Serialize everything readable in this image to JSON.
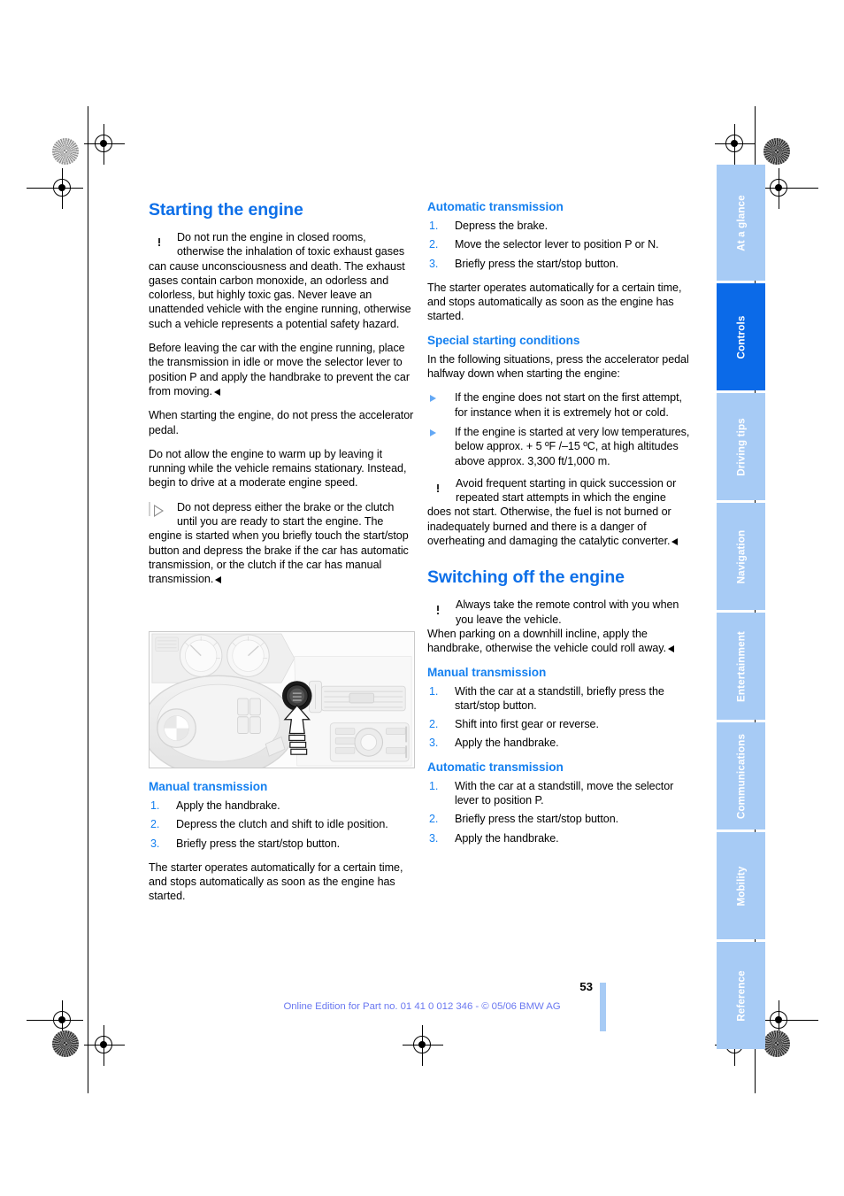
{
  "document": {
    "page_number": "53",
    "footer_note": "Online Edition for Part no. 01 41 0 012 346 - © 05/06 BMW AG"
  },
  "colors": {
    "heading_blue": "#0d6fe8",
    "subheading_blue": "#1580f0",
    "tab_blue": "#a7cbf5",
    "tab_active_blue": "#0b6ae8",
    "footer_blue": "#6a78f0"
  },
  "left_column": {
    "title": "Starting the engine",
    "warning_1": "Do not run the engine in closed rooms, otherwise the inhalation of toxic exhaust gases can cause unconsciousness and death. The exhaust gases contain carbon monoxide, an odorless and colorless, but highly toxic gas. Never leave an unattended vehicle with the engine running, otherwise such a vehicle represents a potential safety hazard.",
    "warning_1b": "Before leaving the car with the engine running, place the transmission in idle or move the selector lever to position P and apply the handbrake to prevent the car from moving.",
    "para_1": "When starting the engine, do not press the accelerator pedal.",
    "para_2": "Do not allow the engine to warm up by leaving it running while the vehicle remains stationary. Instead, begin to drive at a moderate engine speed.",
    "note_1": "Do not depress either the brake or the clutch until you are ready to start the engine. The engine is started when you briefly touch the start/stop button and depress the brake if the car has automatic transmission, or the clutch if the car has manual transmission.",
    "figure_caption": "Dashboard view showing the start/stop button next to the steering wheel, indicated by an arrow",
    "manual_transmission": {
      "heading": "Manual transmission",
      "steps": [
        "Apply the handbrake.",
        "Depress the clutch and shift to idle position.",
        "Briefly press the start/stop button."
      ],
      "closing": "The starter operates automatically for a certain time, and stops automatically as soon as the engine has started."
    }
  },
  "right_column": {
    "automatic_transmission_start": {
      "heading": "Automatic transmission",
      "steps": [
        "Depress the brake.",
        "Move the selector lever to position P or N.",
        "Briefly press the start/stop button."
      ],
      "closing": "The starter operates automatically for a certain time, and stops automatically as soon as the engine has started."
    },
    "special_starting_conditions": {
      "heading": "Special starting conditions",
      "intro": "In the following situations, press the accelerator pedal halfway down when starting the engine:",
      "bullets": [
        "If the engine does not start on the first attempt, for instance when it is extremely hot or cold.",
        "If the engine is started at very low temperatures, below approx. + 5 ºF /–15 ºC, at high altitudes above approx. 3,300 ft/1,000 m."
      ],
      "warning": "Avoid frequent starting in quick succession or repeated start attempts in which the engine does not start. Otherwise, the fuel is not burned or inadequately burned and there is a danger of overheating and damaging the catalytic converter."
    },
    "switching_off": {
      "title": "Switching off the engine",
      "warning": "Always take the remote control with you when you leave the vehicle.",
      "warning_b": "When parking on a downhill incline, apply the handbrake, otherwise the vehicle could roll away.",
      "manual_transmission": {
        "heading": "Manual transmission",
        "steps": [
          "With the car at a standstill, briefly press the start/stop button.",
          "Shift into first gear or reverse.",
          "Apply the handbrake."
        ]
      },
      "automatic_transmission": {
        "heading": "Automatic transmission",
        "steps": [
          "With the car at a standstill, move the selector lever to position P.",
          "Briefly press the start/stop button.",
          "Apply the handbrake."
        ]
      }
    }
  },
  "tabs": [
    {
      "label": "At a glance",
      "active": false
    },
    {
      "label": "Controls",
      "active": true
    },
    {
      "label": "Driving tips",
      "active": false
    },
    {
      "label": "Navigation",
      "active": false
    },
    {
      "label": "Entertainment",
      "active": false
    },
    {
      "label": "Communications",
      "active": false
    },
    {
      "label": "Mobility",
      "active": false
    },
    {
      "label": "Reference",
      "active": false
    }
  ]
}
